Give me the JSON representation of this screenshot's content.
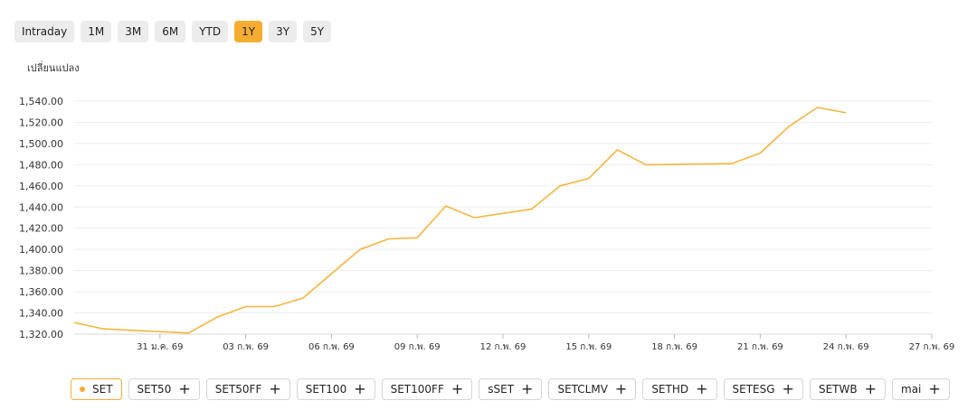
{
  "range_tabs": [
    {
      "label": "Intraday",
      "active": false
    },
    {
      "label": "1M",
      "active": false
    },
    {
      "label": "3M",
      "active": false
    },
    {
      "label": "6M",
      "active": false
    },
    {
      "label": "YTD",
      "active": false
    },
    {
      "label": "1Y",
      "active": true
    },
    {
      "label": "3Y",
      "active": false
    },
    {
      "label": "5Y",
      "active": false
    }
  ],
  "chart_data": {
    "type": "line",
    "ylabel": "เปลี่ยนแปลง",
    "ylim": [
      1320,
      1540
    ],
    "yticks": [
      "1,320.00",
      "1,340.00",
      "1,360.00",
      "1,380.00",
      "1,400.00",
      "1,420.00",
      "1,440.00",
      "1,460.00",
      "1,480.00",
      "1,500.00",
      "1,520.00",
      "1,540.00"
    ],
    "ytick_values": [
      1320,
      1340,
      1360,
      1380,
      1400,
      1420,
      1440,
      1460,
      1480,
      1500,
      1520,
      1540
    ],
    "x_tick_labels": [
      "31 ม.ค. 69",
      "03 ก.พ. 69",
      "06 ก.พ. 69",
      "09 ก.พ. 69",
      "12 ก.พ. 69",
      "15 ก.พ. 69",
      "18 ก.พ. 69",
      "21 ก.พ. 69",
      "24 ก.พ. 69",
      "27 ก.พ. 69"
    ],
    "x_tick_days": [
      3,
      6,
      9,
      12,
      15,
      18,
      21,
      24,
      27,
      30
    ],
    "grid": true,
    "accent": "#f5b53f",
    "series": [
      {
        "x": [
          0,
          1,
          4,
          5,
          6,
          7,
          8,
          10,
          11,
          12,
          13,
          14,
          16,
          17,
          18,
          19,
          20,
          23,
          24,
          25,
          26,
          27
        ],
        "values": [
          1331,
          1325,
          1321,
          1336,
          1346,
          1346,
          1354,
          1400,
          1410,
          1411,
          1441,
          1430,
          1438,
          1460,
          1467,
          1494,
          1480,
          1481,
          1491,
          1516,
          1534,
          1529
        ]
      }
    ]
  },
  "chips": [
    {
      "label": "SET",
      "active": true
    },
    {
      "label": "SET50",
      "active": false
    },
    {
      "label": "SET50FF",
      "active": false
    },
    {
      "label": "SET100",
      "active": false
    },
    {
      "label": "SET100FF",
      "active": false
    },
    {
      "label": "sSET",
      "active": false
    },
    {
      "label": "SETCLMV",
      "active": false
    },
    {
      "label": "SETHD",
      "active": false
    },
    {
      "label": "SETESG",
      "active": false
    },
    {
      "label": "SETWB",
      "active": false
    },
    {
      "label": "mai",
      "active": false
    }
  ],
  "icons": {
    "plus": "+"
  }
}
